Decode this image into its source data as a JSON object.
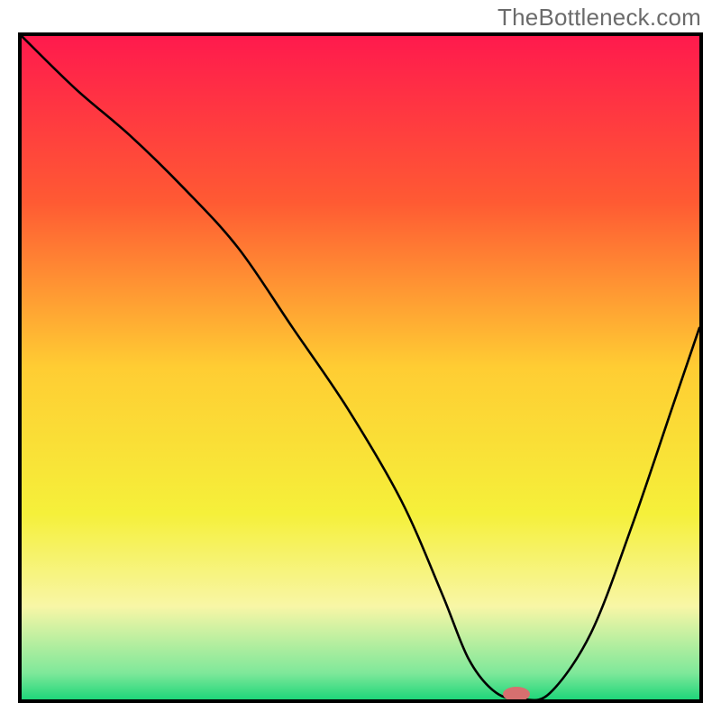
{
  "watermark": "TheBottleneck.com",
  "chart_data": {
    "type": "line",
    "title": "",
    "xlabel": "",
    "ylabel": "",
    "xlim": [
      0,
      100
    ],
    "ylim": [
      0,
      100
    ],
    "grid": false,
    "legend": false,
    "gradient_stops": [
      {
        "pos": 0.0,
        "color": "#ff1a4d"
      },
      {
        "pos": 0.25,
        "color": "#ff5a33"
      },
      {
        "pos": 0.5,
        "color": "#ffcd33"
      },
      {
        "pos": 0.72,
        "color": "#f5f03a"
      },
      {
        "pos": 0.86,
        "color": "#f8f6a6"
      },
      {
        "pos": 0.96,
        "color": "#7fe89a"
      },
      {
        "pos": 1.0,
        "color": "#1fd67a"
      }
    ],
    "series": [
      {
        "name": "bottleneck-curve",
        "x": [
          0,
          8,
          16,
          24,
          32,
          40,
          48,
          56,
          62,
          66,
          70,
          74,
          78,
          84,
          90,
          96,
          100
        ],
        "y": [
          100,
          92,
          85,
          77,
          68,
          56,
          44,
          30,
          16,
          6,
          1,
          0,
          1,
          10,
          26,
          44,
          56
        ]
      }
    ],
    "optimum_marker": {
      "x": 73,
      "y": 0.8,
      "rx_pct": 2.0,
      "ry_pct": 1.1,
      "color": "#d66f6f"
    }
  }
}
